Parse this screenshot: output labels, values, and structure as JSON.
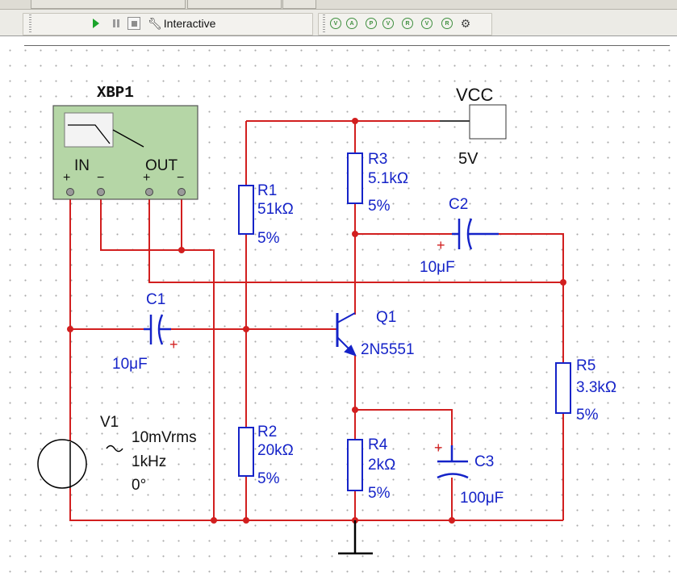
{
  "toolbar": {
    "mode_label": "Interactive",
    "icons": [
      "play-icon",
      "pause-icon",
      "stop-icon",
      "wrench-icon",
      "probe-icon",
      "gear-icon"
    ],
    "probe_glyphs": [
      "V",
      "A",
      "P",
      "V",
      "R",
      "V",
      "R"
    ]
  },
  "instrument": {
    "name": "XBP1",
    "in_label": "IN",
    "out_label": "OUT",
    "plus": "+",
    "minus": "−"
  },
  "power": {
    "name": "VCC",
    "value": "5V"
  },
  "components": {
    "r1": {
      "name": "R1",
      "value": "51kΩ",
      "tol": "5%"
    },
    "r2": {
      "name": "R2",
      "value": "20kΩ",
      "tol": "5%"
    },
    "r3": {
      "name": "R3",
      "value": "5.1kΩ",
      "tol": "5%"
    },
    "r4": {
      "name": "R4",
      "value": "2kΩ",
      "tol": "5%"
    },
    "r5": {
      "name": "R5",
      "value": "3.3kΩ",
      "tol": "5%"
    },
    "c1": {
      "name": "C1",
      "value": "10μF"
    },
    "c2": {
      "name": "C2",
      "value": "10μF"
    },
    "c3": {
      "name": "C3",
      "value": "100μF"
    },
    "q1": {
      "name": "Q1",
      "model": "2N5551"
    },
    "v1": {
      "name": "V1",
      "amplitude": "10mVrms",
      "freq": "1kHz",
      "phase": "0°"
    },
    "polarity_plus": "+"
  },
  "colors": {
    "wire": "#d21f1f",
    "component": "#1523c8",
    "instrument_fill": "#b5d6a6",
    "ground": "#000000"
  }
}
